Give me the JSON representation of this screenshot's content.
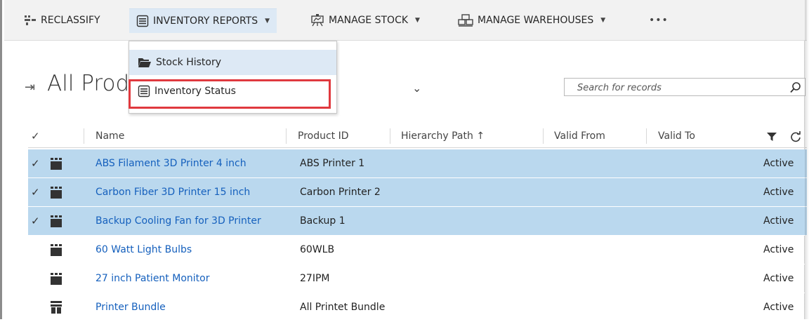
{
  "command_bar": {
    "reclassify": "RECLASSIFY",
    "inventory_reports": "INVENTORY REPORTS",
    "manage_stock": "MANAGE STOCK",
    "manage_warehouses": "MANAGE WAREHOUSES",
    "more": "•••",
    "caret": "▼"
  },
  "dropdown": {
    "items": [
      {
        "label": "Stock History",
        "icon": "folder-open-icon"
      },
      {
        "label": "Inventory Status",
        "icon": "report-list-icon"
      }
    ]
  },
  "view": {
    "pin_glyph": "⇥",
    "title": "All Products and Bundles",
    "caret": "⌄"
  },
  "search": {
    "placeholder": "Search for records"
  },
  "grid": {
    "columns": [
      "Name",
      "Product ID",
      "Hierarchy Path ↑",
      "Valid From",
      "Valid To"
    ],
    "check_glyph": "✓",
    "rows": [
      {
        "name": "ABS Filament 3D Printer 4 inch",
        "product_id": "ABS Printer 1",
        "status": "Active",
        "selected": true,
        "icon": "product-icon"
      },
      {
        "name": "Carbon Fiber 3D Printer 15 inch",
        "product_id": "Carbon Printer 2",
        "status": "Active",
        "selected": true,
        "icon": "product-icon"
      },
      {
        "name": "Backup Cooling Fan for 3D Printer",
        "product_id": "Backup 1",
        "status": "Active",
        "selected": true,
        "icon": "product-icon"
      },
      {
        "name": "60 Watt Light Bulbs",
        "product_id": "60WLB",
        "status": "Active",
        "selected": false,
        "icon": "product-icon"
      },
      {
        "name": "27 inch Patient Monitor",
        "product_id": "27IPM",
        "status": "Active",
        "selected": false,
        "icon": "product-icon"
      },
      {
        "name": "Printer Bundle",
        "product_id": "All Printet Bundle",
        "status": "Active",
        "selected": false,
        "icon": "bundle-icon"
      }
    ]
  },
  "colors": {
    "selected_row": "#bad8ee",
    "link": "#1560bd",
    "highlight_box": "#e0393e",
    "command_bar_bg": "#f2f2f2"
  }
}
